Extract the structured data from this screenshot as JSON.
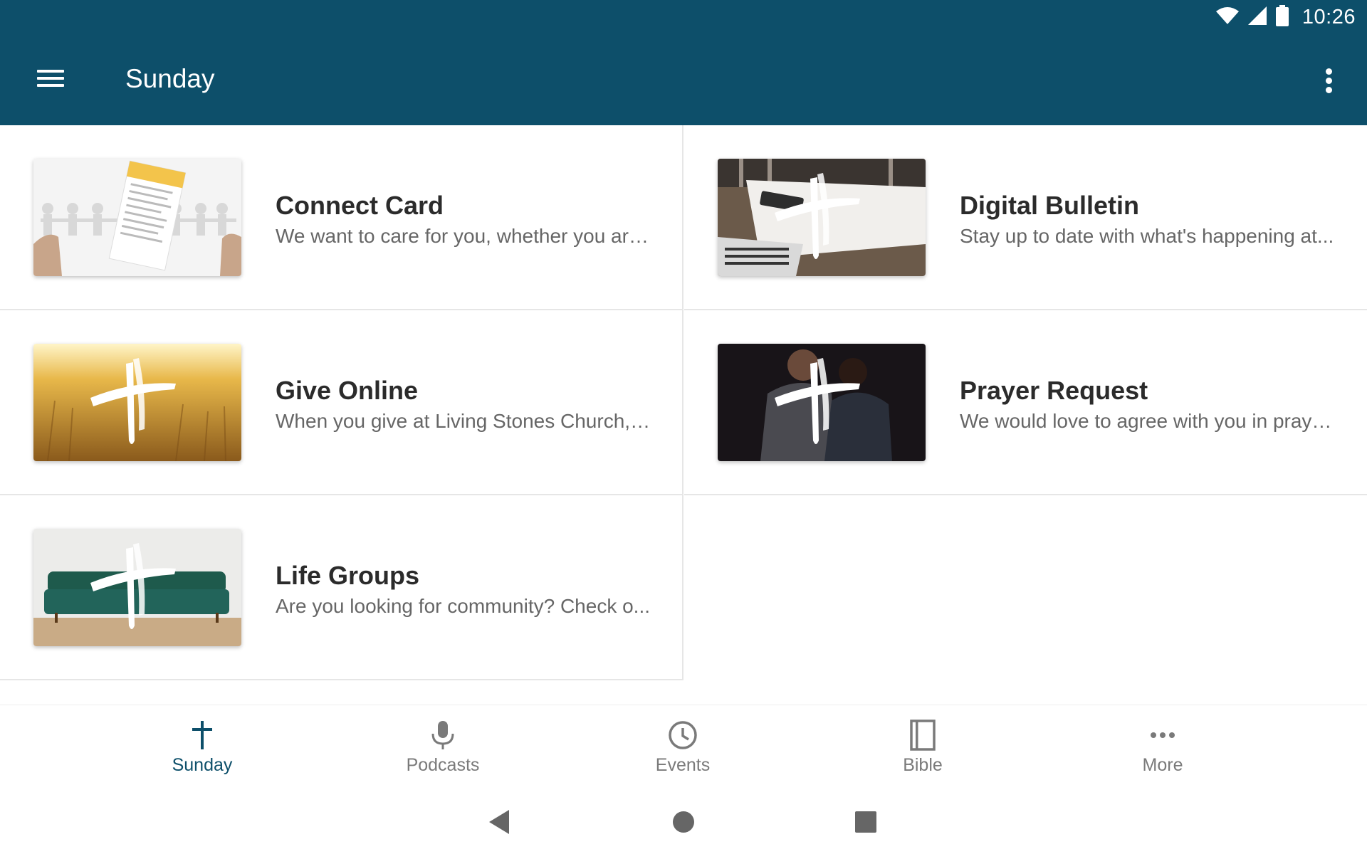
{
  "status_bar": {
    "time": "10:26"
  },
  "app_bar": {
    "title": "Sunday"
  },
  "cards": [
    {
      "title": "Connect Card",
      "description": "We want to care for you, whether you are...",
      "thumbnail": "connect-card-image"
    },
    {
      "title": "Digital Bulletin",
      "description": "Stay up to date with what's happening at...",
      "thumbnail": "digital-bulletin-image"
    },
    {
      "title": "Give Online",
      "description": "When you give at Living Stones Church, y...",
      "thumbnail": "give-online-image"
    },
    {
      "title": "Prayer Request",
      "description": "We would love to agree with you in praye...",
      "thumbnail": "prayer-request-image"
    },
    {
      "title": "Life Groups",
      "description": "Are you looking for community? Check o...",
      "thumbnail": "life-groups-image"
    }
  ],
  "bottom_nav": {
    "tabs": [
      {
        "label": "Sunday",
        "icon": "cross-icon",
        "active": true
      },
      {
        "label": "Podcasts",
        "icon": "microphone-icon",
        "active": false
      },
      {
        "label": "Events",
        "icon": "clock-icon",
        "active": false
      },
      {
        "label": "Bible",
        "icon": "book-icon",
        "active": false
      },
      {
        "label": "More",
        "icon": "more-horizontal-icon",
        "active": false
      }
    ]
  },
  "colors": {
    "primary": "#0d4f6a",
    "inactive": "#7a7a7a",
    "divider": "#e6e6e6"
  }
}
